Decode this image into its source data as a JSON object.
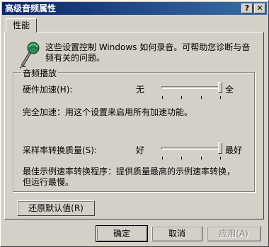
{
  "window": {
    "title": "高级音频属性",
    "help_glyph": "?",
    "close_glyph": "✕"
  },
  "tab": {
    "label": "性能"
  },
  "description": "这些设置控制 Windows 如何录音。可帮助您诊断与音频有关的问题。",
  "group": {
    "label": "音频播放"
  },
  "hardware_accel": {
    "label": "硬件加速(H):",
    "min_label": "无",
    "max_label": "全",
    "value": 1.0,
    "description": "完全加速：用这个设置来启用所有加速功能。"
  },
  "sample_rate": {
    "label": "采样率转换质量(S):",
    "min_label": "好",
    "max_label": "最好",
    "value": 1.0,
    "description": "最佳示例速率转换程序：提供质量最高的示例速率转换，但运行最慢。"
  },
  "buttons": {
    "restore_defaults": "还原默认值(R)",
    "ok": "确定",
    "cancel": "取消",
    "apply": "应用(A)"
  }
}
